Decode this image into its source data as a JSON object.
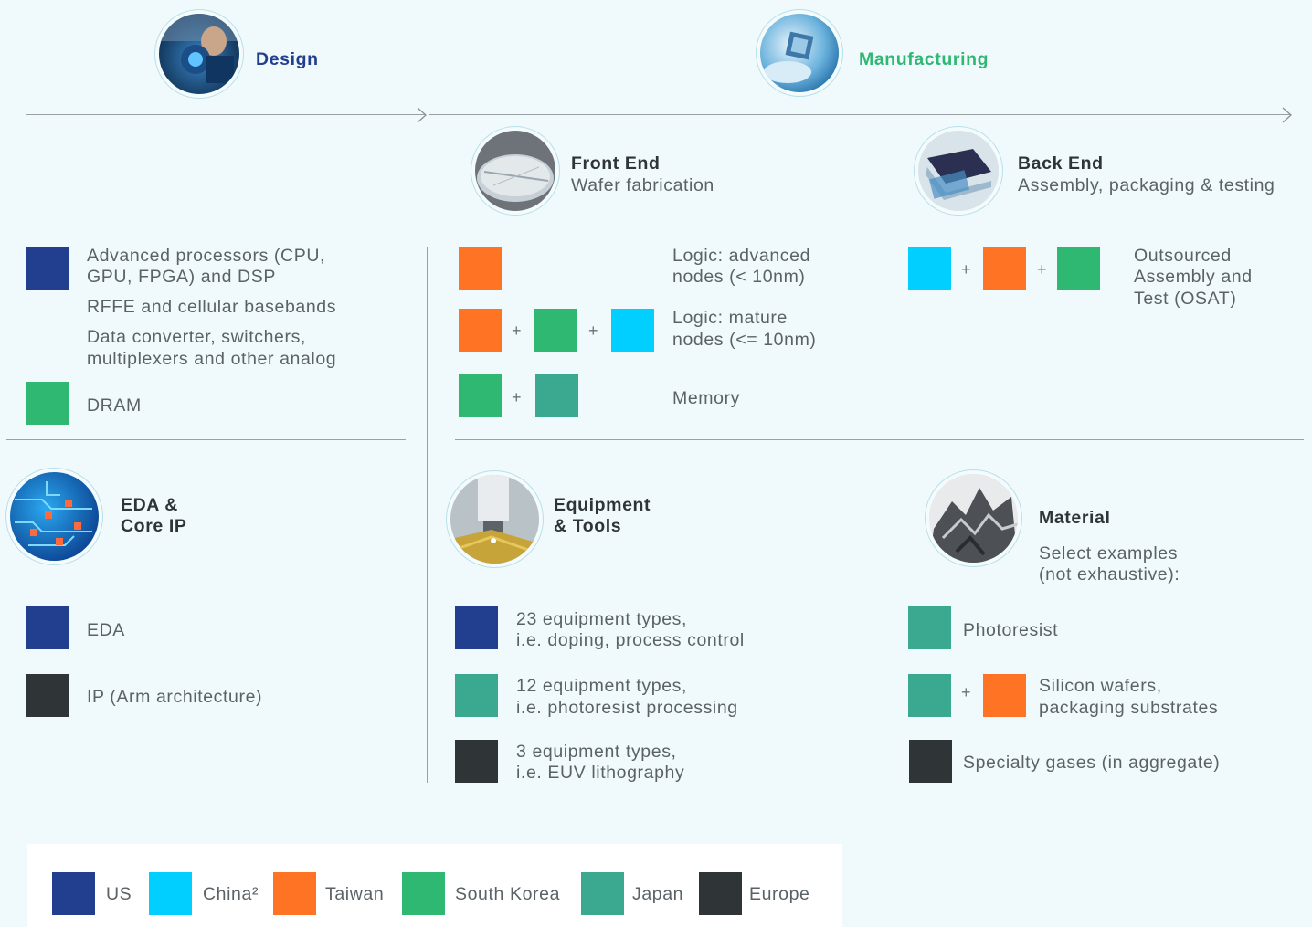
{
  "colors": {
    "us": "#213e8f",
    "china": "#00cfff",
    "taiwan": "#ff7324",
    "south_korea": "#2eb872",
    "japan": "#3ba98f",
    "europe": "#2f3437"
  },
  "stages": {
    "design": "Design",
    "manufacturing": "Manufacturing"
  },
  "front_end": {
    "title": "Front End",
    "subtitle": "Wafer fabrication"
  },
  "back_end": {
    "title": "Back End",
    "subtitle": "Assembly, packaging & testing"
  },
  "design_items": {
    "processors": [
      "Advanced processors (CPU,",
      "GPU, FPGA) and DSP"
    ],
    "rffe": "RFFE and cellular basebands",
    "converters": [
      "Data converter, switchers,",
      "multiplexers and other analog"
    ],
    "dram": "DRAM"
  },
  "front_end_items": {
    "logic_advanced": [
      "Logic: advanced",
      "nodes (< 10nm)"
    ],
    "logic_mature": [
      "Logic: mature",
      "nodes (<= 10nm)"
    ],
    "memory": "Memory"
  },
  "back_end_items": {
    "osat": [
      "Outsourced",
      "Assembly and",
      "Test (OSAT)"
    ]
  },
  "eda": {
    "title": [
      "EDA &",
      "Core IP"
    ],
    "items": [
      "EDA",
      "IP (Arm architecture)"
    ]
  },
  "equipment": {
    "title": [
      "Equipment",
      "& Tools"
    ],
    "items": [
      [
        "23 equipment types,",
        "i.e. doping, process control"
      ],
      [
        "12 equipment types,",
        "i.e. photoresist processing"
      ],
      [
        "3 equipment types,",
        "i.e. EUV lithography"
      ]
    ]
  },
  "material": {
    "title": "Material",
    "subtitle": [
      "Select examples",
      "(not exhaustive):"
    ],
    "items": {
      "photoresist": "Photoresist",
      "wafers": [
        "Silicon wafers,",
        "packaging substrates"
      ],
      "gases": "Specialty gases (in aggregate)"
    }
  },
  "plus": "+",
  "legend": [
    "US",
    "China²",
    "Taiwan",
    "South Korea",
    "Japan",
    "Europe"
  ],
  "icons": {
    "design": "engineer-photo-icon",
    "manufacturing": "chip-in-hand-photo-icon",
    "front_end": "wafer-photo-icon",
    "back_end": "wafer-cassette-photo-icon",
    "eda": "circuit-board-photo-icon",
    "equipment": "microscope-photo-icon",
    "material": "silicon-material-photo-icon"
  }
}
